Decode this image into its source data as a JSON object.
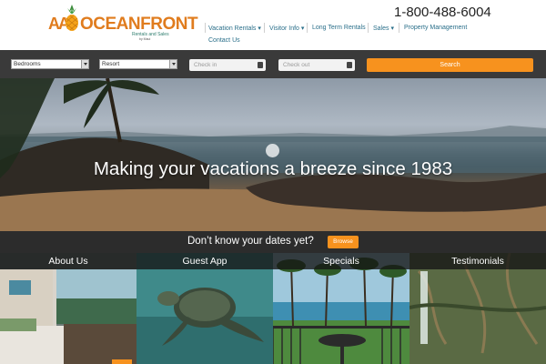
{
  "brand": {
    "logo_aa": "AA",
    "logo_name": "OCEANFRONT",
    "logo_sub": "Rentals and Sales",
    "logo_sub2": "by Maui",
    "phone": "1-800-488-6004"
  },
  "nav": {
    "items": [
      {
        "label": "Vacation Rentals",
        "caret": true
      },
      {
        "label": "Visitor Info",
        "caret": true
      },
      {
        "label": "Long Term Rentals",
        "caret": false
      },
      {
        "label": "Sales",
        "caret": true
      },
      {
        "label": "Property Management",
        "caret": false
      },
      {
        "label": "Contact Us",
        "caret": false
      }
    ]
  },
  "search": {
    "bedrooms": "Bedrooms",
    "resort": "Resort",
    "checkin_placeholder": "Check in",
    "checkout_placeholder": "Check out",
    "button": "Search"
  },
  "hero": {
    "title": "Making your vacations a breeze since 1983"
  },
  "dates_banner": {
    "text": "Don’t know your dates yet?",
    "button": "Browse"
  },
  "tiles": [
    {
      "label": "About Us"
    },
    {
      "label": "Guest App"
    },
    {
      "label": "Specials"
    },
    {
      "label": "Testimonials"
    }
  ],
  "colors": {
    "accent": "#f7921e",
    "nav_link": "#2a6f8a",
    "dark_bar": "#3a3a3a"
  }
}
